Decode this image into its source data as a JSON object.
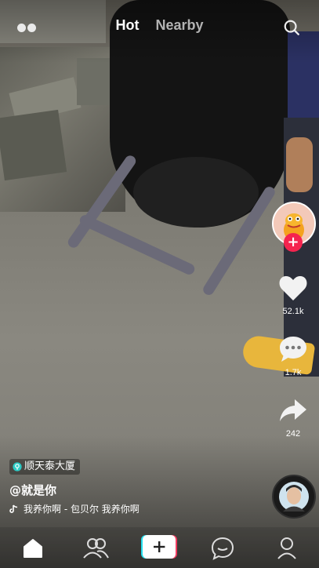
{
  "colors": {
    "accent_red": "#f5244f",
    "white": "#ffffff",
    "tab_inactive": "#cfcfcf",
    "add_button_cyan": "#24e0ef",
    "add_button_pink": "#f23c61"
  },
  "topbar": {
    "menu_icon": "dots-icon",
    "tabs": [
      {
        "label": "Hot",
        "active": true
      },
      {
        "label": "Nearby",
        "active": false
      }
    ],
    "search_icon": "search-icon"
  },
  "sidebar": {
    "like_count": "52.1k",
    "comment_count": "1.7k",
    "share_count": "242"
  },
  "caption": {
    "location": "顺天泰大厦",
    "username": "@就是你",
    "music": "我养你啊 - 包贝尔    我养你啊"
  },
  "bottom_nav": {
    "items": [
      "home-icon",
      "friends-icon",
      "add-icon",
      "messages-icon",
      "profile-icon"
    ]
  }
}
